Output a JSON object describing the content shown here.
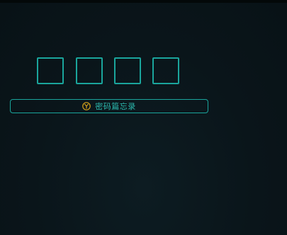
{
  "pin": {
    "boxes": [
      "",
      "",
      "",
      ""
    ]
  },
  "hint": {
    "label": "密码篇忘录",
    "icon": "y-circle-icon"
  },
  "colors": {
    "background": "#0b161b",
    "accent": "#1aa59c",
    "text": "#2bb9ae",
    "icon": "#d4a01a"
  }
}
